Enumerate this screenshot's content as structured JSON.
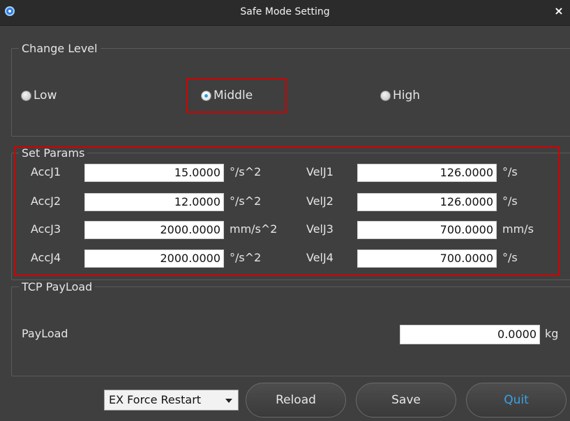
{
  "window": {
    "title": "Safe Mode Setting",
    "close_glyph": "×"
  },
  "change_level": {
    "legend": "Change Level",
    "options": [
      {
        "label": "Low",
        "checked": false
      },
      {
        "label": "Middle",
        "checked": true
      },
      {
        "label": "High",
        "checked": false
      }
    ]
  },
  "set_params": {
    "legend": "Set Params",
    "rows": [
      {
        "acc_label": "AccJ1",
        "acc_value": "15.0000",
        "acc_unit": "°/s^2",
        "vel_label": "VelJ1",
        "vel_value": "126.0000",
        "vel_unit": "°/s"
      },
      {
        "acc_label": "AccJ2",
        "acc_value": "12.0000",
        "acc_unit": "°/s^2",
        "vel_label": "VelJ2",
        "vel_value": "126.0000",
        "vel_unit": "°/s"
      },
      {
        "acc_label": "AccJ3",
        "acc_value": "2000.0000",
        "acc_unit": "mm/s^2",
        "vel_label": "VelJ3",
        "vel_value": "700.0000",
        "vel_unit": "mm/s"
      },
      {
        "acc_label": "AccJ4",
        "acc_value": "2000.0000",
        "acc_unit": "°/s^2",
        "vel_label": "VelJ4",
        "vel_value": "700.0000",
        "vel_unit": "°/s"
      }
    ]
  },
  "tcp_payload": {
    "legend": "TCP PayLoad",
    "label": "PayLoad",
    "value": "0.0000",
    "unit": "kg"
  },
  "footer": {
    "dropdown_value": "EX Force Restart",
    "reload_label": "Reload",
    "save_label": "Save",
    "quit_label": "Quit"
  },
  "colors": {
    "highlight": "#d60000",
    "radio_selected": "#2aa0e6",
    "quit_text": "#3aa0e8",
    "background": "#3f3f3f"
  }
}
